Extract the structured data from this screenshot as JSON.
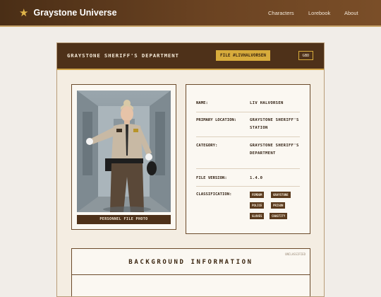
{
  "header": {
    "brand": "Graystone Universe",
    "nav": [
      "Characters",
      "Lorebook",
      "About"
    ]
  },
  "card": {
    "department": "GRAYSTONE SHERIFF'S DEPARTMENT",
    "file_badge": "FILE #LIVHALVORSEN",
    "gbd_label": "GBD",
    "photo_caption": "PERSONNEL FILE PHOTO",
    "fields": [
      {
        "key": "NAME:",
        "value": "LIV HALVORSEN"
      },
      {
        "key": "PRIMARY LOCATION:",
        "value": "GRAYSTONE SHERIFF'S STATION"
      },
      {
        "key": "CATEGORY:",
        "value": "GRAYSTONE SHERIFF'S DEPARTMENT"
      },
      {
        "key": "FILE VERSION:",
        "value": "1.4.0"
      },
      {
        "key": "CLASSIFICATION:",
        "value": ""
      }
    ],
    "tags": [
      "FEMDOM",
      "GRAYSTONE",
      "POLICE",
      "PRISON",
      "GLOVES",
      "CHASTITY"
    ]
  },
  "background": {
    "stamp": "UNCLASSIFIED",
    "title": "BACKGROUND INFORMATION"
  },
  "colors": {
    "header_brown": "#4e3119",
    "accent_gold": "#d8ac3c",
    "paper": "#fbf8f2"
  }
}
